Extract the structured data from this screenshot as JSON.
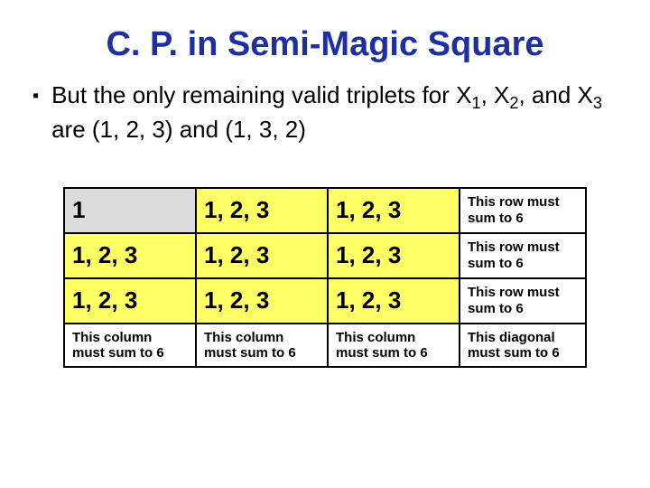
{
  "title": "C. P. in Semi-Magic Square",
  "bullet": {
    "pre": "But the only remaining valid triplets for X",
    "s1": "1",
    "mid1": ", X",
    "s2": "2",
    "mid2": ", and X",
    "s3": "3",
    "post": " are (1, 2, 3) and (1, 3, 2)"
  },
  "grid": {
    "r0": {
      "c0": "1",
      "c1": "1, 2, 3",
      "c2": "1, 2, 3",
      "note": "This row must sum to 6"
    },
    "r1": {
      "c0": "1, 2, 3",
      "c1": "1, 2, 3",
      "c2": "1, 2, 3",
      "note": "This row must sum to 6"
    },
    "r2": {
      "c0": "1, 2, 3",
      "c1": "1, 2, 3",
      "c2": "1, 2, 3",
      "note": "This row must sum to 6"
    },
    "footer": {
      "c0": "This column must sum to 6",
      "c1": "This column must sum to 6",
      "c2": "This column must sum to 6",
      "diag": "This diagonal must sum to 6"
    }
  }
}
